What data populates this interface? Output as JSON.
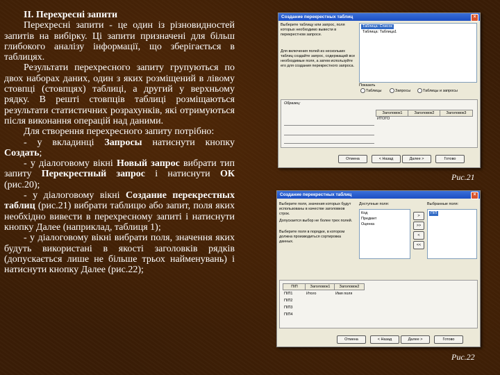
{
  "text": {
    "title": "ІІ. Перехресні запити",
    "p1": "Перехресні запити - це один із різновидностей запитів на вибірку. Ці запити призначені для більш глибокого аналізу інформації, що зберігається в таблицях.",
    "p2": "Результати перехресного запиту групуються по двох наборах даних, один з яких розміщений в лівому стовпці (стовпцях) таблиці, а другий у верхньому рядку. В решті стовпців таблиці розміщаються результати статистичних розрахунків, які отримуються після виконання операцій над даними.",
    "p3": "Для створення перехресного запиту потрібно:",
    "s1_a": "- у вкладинці ",
    "s1_b": "Запросы",
    "s1_c": " натиснути кнопку ",
    "s1_d": "Создать",
    "s1_e": ";",
    "s2_a": "- у діалоговому вікні ",
    "s2_b": "Новый запрос",
    "s2_c": " вибрати тип запиту ",
    "s2_d": "Перекрестный запрос",
    "s2_e": " і натиснути ",
    "s2_f": "ОК",
    "s2_g": " (рис.20);",
    "s3_a": "- у діалоговому вікні ",
    "s3_b": "Создание перекрестных таблиц",
    "s3_c": " (рис.21) вибрати таблицю або запит, поля яких необхідно вивести в перехресному запиті і натиснути кнопку Далее (наприклад, таблиця 1);",
    "s4": "- у діалоговому вікні вибрати поля, значення яких будуть використані в якості заголовків рядків (допускається лише не більше трьох найменувань) і натиснути кнопку Далее (рис.22);"
  },
  "fig21": {
    "caption": "Рис.21",
    "window_title": "Создание перекрестных таблиц",
    "intro_text": "Выберите таблицу или запрос, поля которых необходимо вывести в перекрестном запросе.",
    "hint_text": "Для включения полей из нескольких таблиц создайте запрос, содержащий все необходимые поля, а затем используйте его для создания перекрестного запроса.",
    "list_items": [
      "Таблица: Список",
      "Таблица: Таблица1"
    ],
    "radio_group": [
      "Таблицы",
      "Запросы",
      "Таблицы и запросы"
    ],
    "sample_label": "Образец:",
    "sample_headers": [
      "Заголовок1",
      "Заголовок2",
      "Заголовок3"
    ],
    "sample_total": "ИТОГО",
    "buttons": [
      "Отмена",
      "< Назад",
      "Далее >",
      "Готово"
    ]
  },
  "fig22": {
    "caption": "Рис.22",
    "window_title": "Создание перекрестных таблиц",
    "intro_text": "Выберите поля, значения которых будут использованы в качестве заголовков строк.",
    "limit_text": "Допускается выбор не более трех полей.",
    "order_text": "Выберите поля в порядке, в котором должна производиться сортировка данных.",
    "available_label": "Доступные поля:",
    "available_fields": [
      "Код",
      "Предмет",
      "Оценка"
    ],
    "selected_label": "Выбранные поля:",
    "selected_fields": [
      "ПІП"
    ],
    "move_buttons": [
      ">",
      ">>",
      "<",
      "<<"
    ],
    "sample_headers": [
      "ПІП",
      "Заголовок1",
      "Заголовок2"
    ],
    "sample_rows": [
      [
        "ПІП1",
        "Итого",
        "Имя поля"
      ],
      [
        "ПІП2",
        "",
        ""
      ],
      [
        "ПІП3",
        "",
        ""
      ],
      [
        "ПІП4",
        "",
        ""
      ]
    ],
    "buttons": [
      "Отмена",
      "< Назад",
      "Далее >",
      "Готово"
    ]
  }
}
